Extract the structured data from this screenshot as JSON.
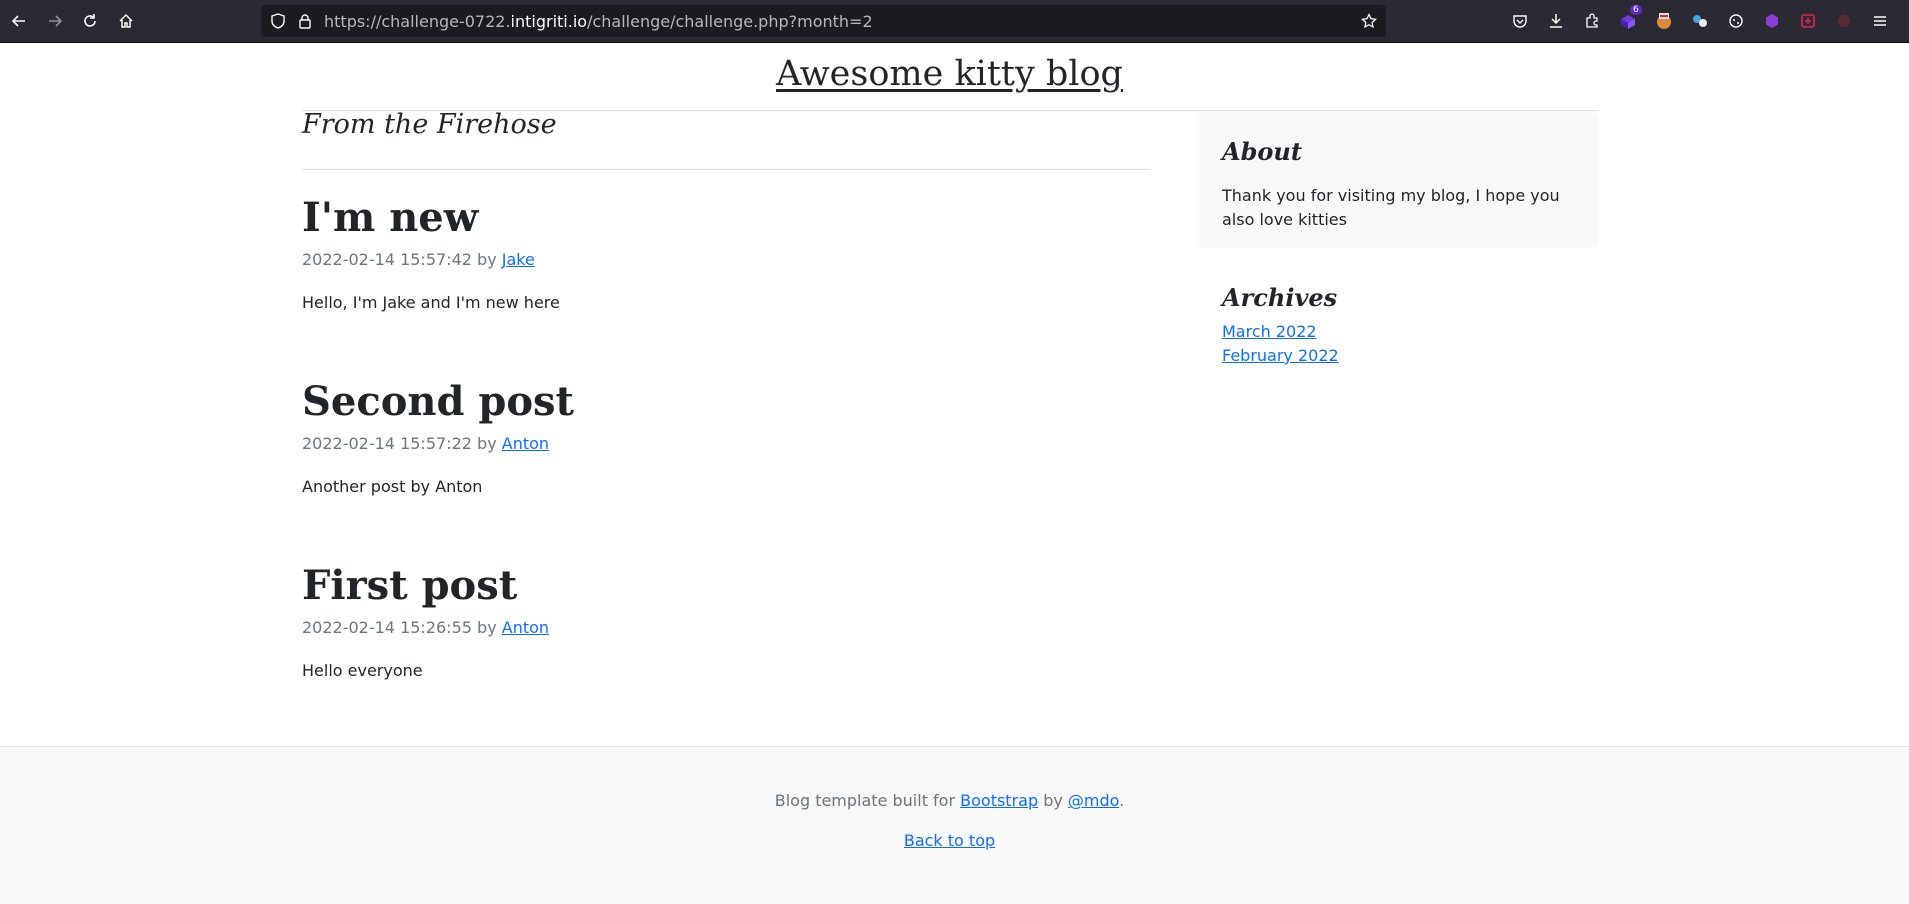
{
  "browser": {
    "url_prefix": "https://challenge-0722.",
    "url_host": "intigriti.io",
    "url_path": "/challenge/challenge.php?month=2",
    "extension_badge": "6"
  },
  "blog": {
    "title": "Awesome kitty blog",
    "section_heading": "From the Firehose",
    "posts": [
      {
        "title": "I'm new",
        "date": "2022-02-14 15:57:42",
        "by": "by",
        "author": "Jake",
        "body": "Hello, I'm Jake and I'm new here"
      },
      {
        "title": "Second post",
        "date": "2022-02-14 15:57:22",
        "by": "by",
        "author": "Anton",
        "body": "Another post by Anton"
      },
      {
        "title": "First post",
        "date": "2022-02-14 15:26:55",
        "by": "by",
        "author": "Anton",
        "body": "Hello everyone"
      }
    ]
  },
  "sidebar": {
    "about_heading": "About",
    "about_text": "Thank you for visiting my blog, I hope you also love kitties",
    "archives_heading": "Archives",
    "archives": [
      "March 2022",
      "February 2022"
    ]
  },
  "footer": {
    "text_before": "Blog template built for ",
    "bootstrap_link": "Bootstrap",
    "text_mid": " by ",
    "mdo_link": "@mdo",
    "text_after": ".",
    "back_to_top": "Back to top"
  },
  "colors": {
    "link": "#0d6efd",
    "muted": "#6c757d",
    "chrome_bg": "#2b2a33"
  }
}
